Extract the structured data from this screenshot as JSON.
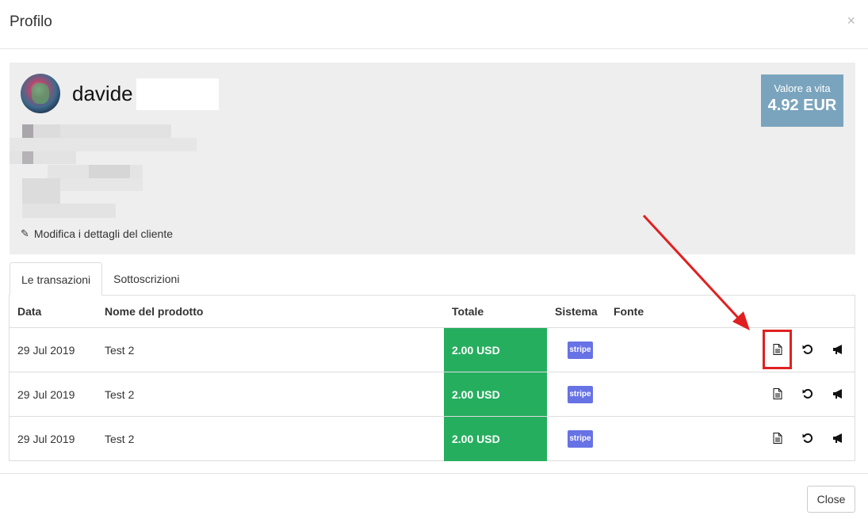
{
  "modal": {
    "title": "Profilo",
    "close_symbol": "×",
    "close_button": "Close"
  },
  "profile": {
    "name": "davide",
    "edit_link": "Modifica i dettagli del cliente",
    "lifetime_label": "Valore a vita",
    "lifetime_value": "4.92 EUR"
  },
  "tabs": [
    {
      "label": "Le transazioni",
      "active": true
    },
    {
      "label": "Sottoscrizioni",
      "active": false
    }
  ],
  "table": {
    "headers": {
      "date": "Data",
      "product": "Nome del prodotto",
      "total": "Totale",
      "system": "Sistema",
      "source": "Fonte"
    },
    "rows": [
      {
        "date": "29 Jul 2019",
        "product": "Test 2",
        "total": "2.00 USD",
        "system": "stripe",
        "source": ""
      },
      {
        "date": "29 Jul 2019",
        "product": "Test 2",
        "total": "2.00 USD",
        "system": "stripe",
        "source": ""
      },
      {
        "date": "29 Jul 2019",
        "product": "Test 2",
        "total": "2.00 USD",
        "system": "stripe",
        "source": ""
      }
    ]
  },
  "icons": {
    "invoice": "document-icon",
    "refund": "undo-icon",
    "notify": "megaphone-icon",
    "edit": "pencil-icon"
  },
  "colors": {
    "total_bg": "#26ae5f",
    "lifetime_bg": "#7aa4bd",
    "stripe_bg": "#6772e5",
    "highlight": "#e02020"
  }
}
